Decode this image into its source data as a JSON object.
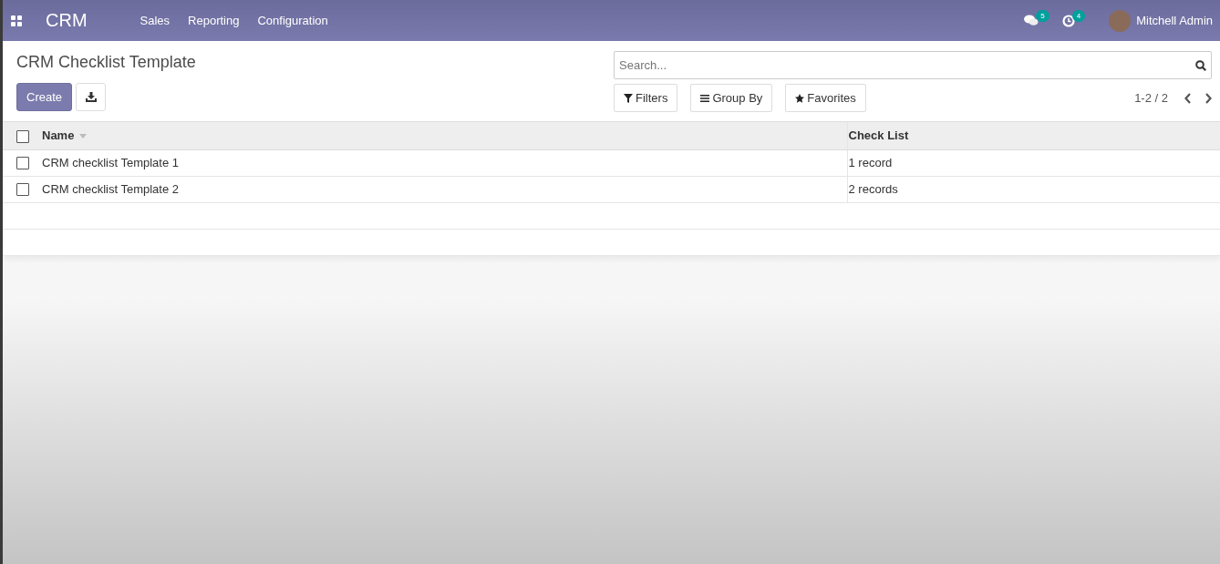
{
  "navbar": {
    "app": "CRM",
    "menu": [
      "Sales",
      "Reporting",
      "Configuration"
    ],
    "messages_count": "5",
    "activities_count": "4",
    "user": "Mitchell Admin"
  },
  "control_panel": {
    "title": "CRM Checklist Template",
    "create": "Create",
    "search": {
      "placeholder": "Search..."
    },
    "filters": [
      "Filters",
      "Group By",
      "Favorites"
    ],
    "pager": "1-2 / 2"
  },
  "table": {
    "select_all_checked": false,
    "columns": [
      "Name",
      "Check List"
    ],
    "rows": [
      {
        "cells": [
          "CRM checklist Template 1",
          "1 record"
        ],
        "checked": false
      },
      {
        "cells": [
          "CRM checklist Template 2",
          "2 records"
        ],
        "checked": false
      }
    ]
  }
}
